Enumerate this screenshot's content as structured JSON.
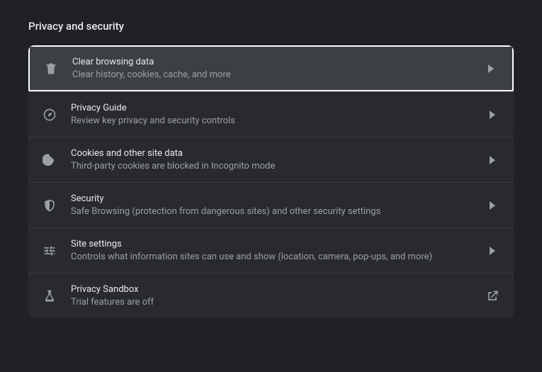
{
  "section": {
    "title": "Privacy and security",
    "items": [
      {
        "title": "Clear browsing data",
        "subtitle": "Clear history, cookies, cache, and more"
      },
      {
        "title": "Privacy Guide",
        "subtitle": "Review key privacy and security controls"
      },
      {
        "title": "Cookies and other site data",
        "subtitle": "Third-party cookies are blocked in Incognito mode"
      },
      {
        "title": "Security",
        "subtitle": "Safe Browsing (protection from dangerous sites) and other security settings"
      },
      {
        "title": "Site settings",
        "subtitle": "Controls what information sites can use and show (location, camera, pop-ups, and more)"
      },
      {
        "title": "Privacy Sandbox",
        "subtitle": "Trial features are off"
      }
    ]
  }
}
